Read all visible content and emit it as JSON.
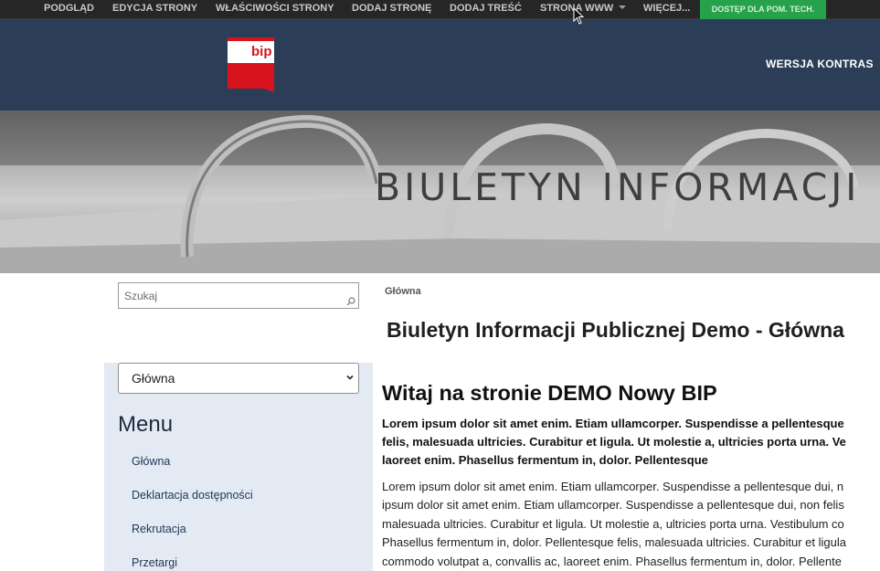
{
  "admin_bar": {
    "items": [
      "PODGLĄD",
      "EDYCJA STRONY",
      "WŁAŚCIWOŚCI STRONY",
      "DODAJ STRONĘ",
      "DODAJ TREŚĆ",
      "STRONA WWW",
      "WIĘCEJ..."
    ],
    "tech_access": "DOSTĘP DLA POM. TECH."
  },
  "header": {
    "logo_text": "bip",
    "contrast_link": "WERSJA KONTRAS"
  },
  "banner": {
    "title": "BIULETYN INFORMACJI"
  },
  "search": {
    "placeholder": "Szukaj"
  },
  "page_select": {
    "selected": "Główna"
  },
  "menu": {
    "heading": "Menu",
    "items": [
      "Główna",
      "Deklartacja dostępności",
      "Rekrutacja",
      "Przetargi"
    ]
  },
  "breadcrumb": "Główna",
  "page_title": "Biuletyn Informacji Publicznej Demo - Główna",
  "content": {
    "section_title": "Witaj na stronie DEMO Nowy BIP",
    "lead_lines": [
      "Lorem ipsum dolor sit amet enim. Etiam ullamcorper. Suspendisse a pellentesque",
      "felis, malesuada ultricies. Curabitur et ligula. Ut molestie a, ultricies porta urna. Ve",
      "laoreet enim. Phasellus fermentum in, dolor. Pellentesque"
    ],
    "body_lines": [
      "Lorem ipsum dolor sit amet enim. Etiam ullamcorper. Suspendisse a pellentesque dui, n",
      "ipsum dolor sit amet enim. Etiam ullamcorper. Suspendisse a pellentesque dui, non felis",
      "malesuada ultricies. Curabitur et ligula. Ut molestie a, ultricies porta urna. Vestibulum co",
      "Phasellus fermentum in, dolor. Pellentesque felis, malesuada ultricies. Curabitur et ligula",
      "commodo volutpat a, convallis ac, laoreet enim. Phasellus fermentum in, dolor. Pellente"
    ]
  },
  "colors": {
    "admin_bar_bg": "#262626",
    "header_bg": "#2c3e57",
    "tech_button_bg": "#26a24a",
    "sidebar_bg": "#e3eaf4",
    "logo_red": "#d7141e"
  }
}
